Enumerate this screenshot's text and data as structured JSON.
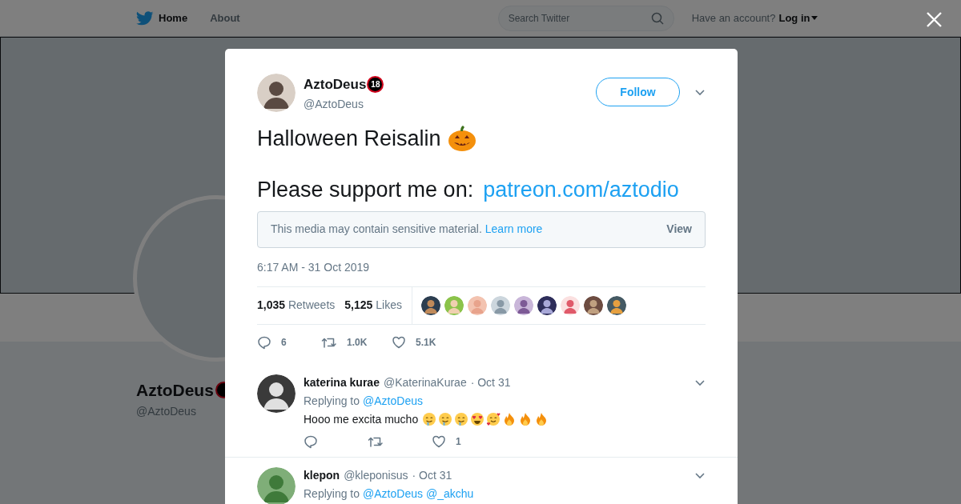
{
  "background_page": {
    "nav": [
      {
        "label": "Home",
        "selected": true
      },
      {
        "label": "About",
        "selected": false
      }
    ],
    "search": {
      "placeholder": "Search Twitter"
    },
    "account_prompt": "Have an account?",
    "login": "Log in",
    "profile_name": "AztoDeus",
    "profile_handle": "@AztoDeus"
  },
  "tweet": {
    "author": {
      "name": "AztoDeus",
      "badge": "18",
      "handle": "@AztoDeus"
    },
    "follow_button": "Follow",
    "text_line_1": "Halloween Reisalin",
    "text_line_2": "Please support me on:",
    "link": "patreon.com/aztodio",
    "sensitive_notice": {
      "text": "This media may contain sensitive material.",
      "link": "Learn more",
      "button": "View"
    },
    "timestamp": "6:17 AM - 31 Oct 2019",
    "stats": [
      {
        "count": "1,035",
        "label": "Retweets"
      },
      {
        "count": "5,125",
        "label": "Likes"
      }
    ],
    "actions": [
      {
        "kind": "reply",
        "count": "6"
      },
      {
        "kind": "retweet",
        "count": "1.0K"
      },
      {
        "kind": "like",
        "count": "5.1K"
      }
    ]
  },
  "replies": [
    {
      "name": "katerina kurae",
      "handle": "@KaterinaKurae",
      "date": "· Oct 31",
      "replying_to": "Replying to",
      "mentions": [
        "@AztoDeus"
      ],
      "text": "Hooo me excita mucho",
      "actions": [
        {
          "kind": "reply"
        },
        {
          "kind": "retweet"
        },
        {
          "kind": "like",
          "count": "1"
        }
      ]
    },
    {
      "name": "klepon",
      "handle": "@kleponisus",
      "date": "· Oct 31",
      "replying_to": "Replying to",
      "mentions": [
        "@AztoDeus",
        "@_akchu"
      ]
    }
  ]
}
